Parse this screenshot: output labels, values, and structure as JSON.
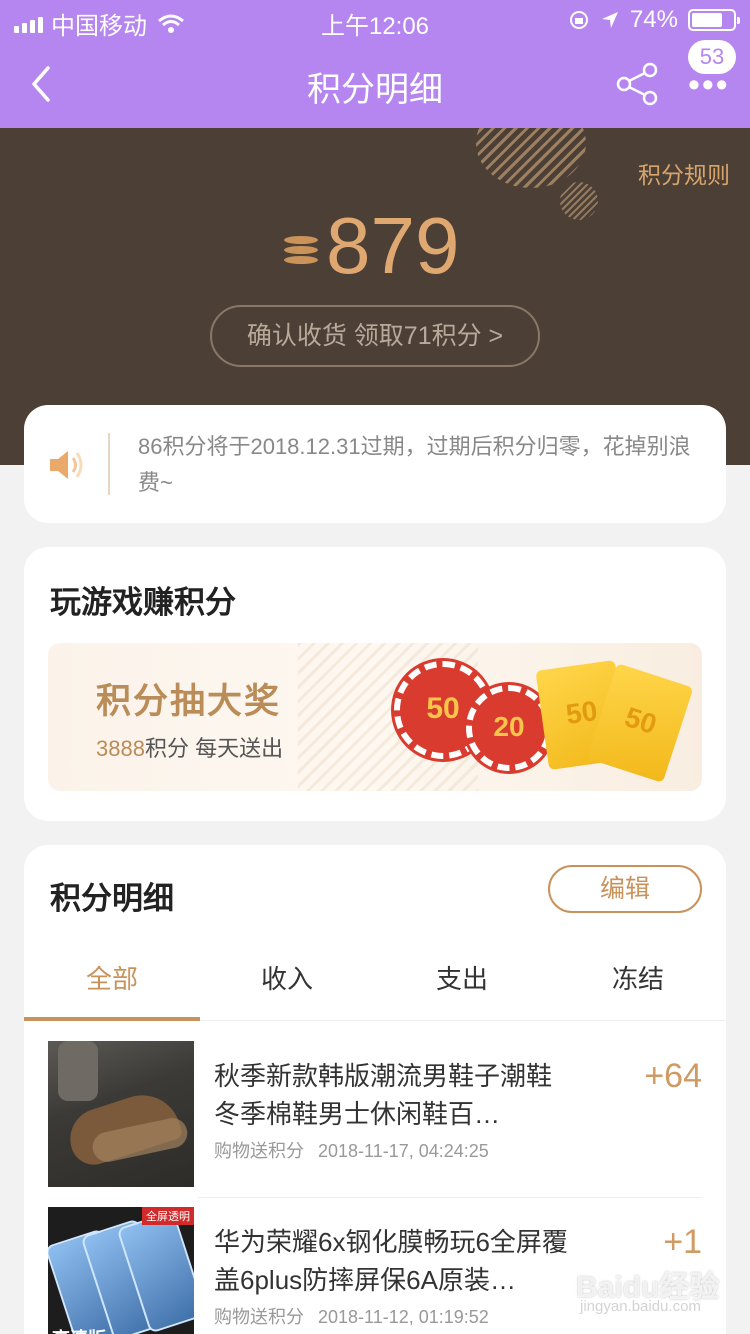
{
  "status_bar": {
    "carrier": "中国移动",
    "time": "上午12:06",
    "battery_percent": "74%",
    "battery_level": 0.74
  },
  "nav": {
    "title": "积分明细",
    "badge_count": "53",
    "icons": [
      "back-arrow-icon",
      "share-icon",
      "more-icon"
    ]
  },
  "hero": {
    "rules_link": "积分规则",
    "points": "879",
    "confirm_button": "确认收货 领取71积分 >"
  },
  "notice": {
    "text": "86积分将于2018.12.31过期，过期后积分归零，花掉别浪费~"
  },
  "game": {
    "title": "玩游戏赚积分",
    "banner_title": "积分抽大奖",
    "banner_sub_number": "3888",
    "banner_sub_text": "积分 每天送出",
    "chip1": "50",
    "chip2": "20",
    "ticket1": "50",
    "ticket2": "50"
  },
  "detail": {
    "title": "积分明细",
    "edit_button": "编辑",
    "tabs": [
      "全部",
      "收入",
      "支出",
      "冻结"
    ],
    "active_tab": 0,
    "records": [
      {
        "name": "秋季新款韩版潮流男鞋子潮鞋冬季棉鞋男士休闲鞋百…",
        "type": "购物送积分",
        "time": "2018-11-17, 04:24:25",
        "delta": "+64"
      },
      {
        "name": "华为荣耀6x钢化膜畅玩6全屏覆盖6plus防摔屏保6A原装…",
        "type": "购物送积分",
        "time": "2018-11-12, 01:19:52",
        "delta": "+1",
        "thumb_tag": "全屏透明",
        "thumb_label": "高清版"
      }
    ]
  },
  "watermark": {
    "brand": "Baidu经验",
    "url": "jingyan.baidu.com"
  },
  "colors": {
    "nav_bg": "#b686f0",
    "hero_bg": "#4c3f36",
    "accent": "#c9925a"
  }
}
